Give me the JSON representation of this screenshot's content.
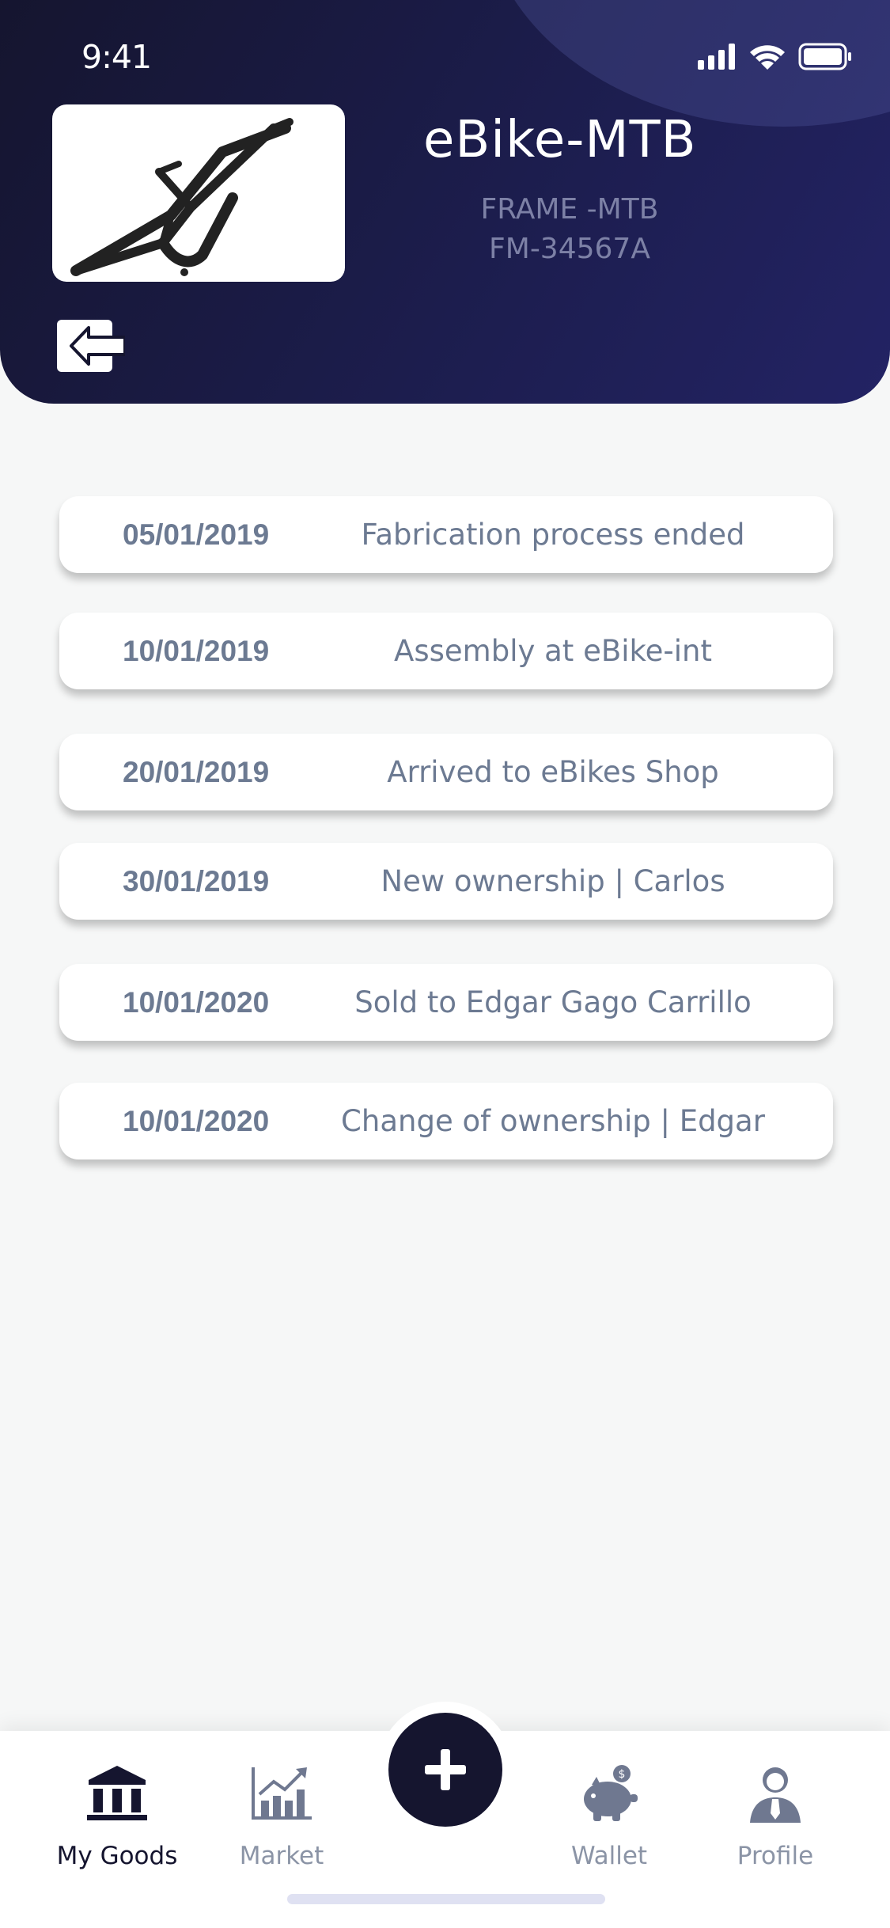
{
  "status_bar": {
    "time": "9:41"
  },
  "product": {
    "title": "eBike-MTB",
    "subtitle_line1": "FRAME -MTB",
    "subtitle_line2": "FM-34567A"
  },
  "events": [
    {
      "date": "05/01/2019",
      "description": "Fabrication process ended"
    },
    {
      "date": "10/01/2019",
      "description": "Assembly at eBike-int"
    },
    {
      "date": "20/01/2019",
      "description": "Arrived to eBikes Shop"
    },
    {
      "date": "30/01/2019",
      "description": "New ownership | Carlos"
    },
    {
      "date": "10/01/2020",
      "description": "Sold to Edgar Gago Carrillo"
    },
    {
      "date": "10/01/2020",
      "description": "Change of ownership | Edgar"
    }
  ],
  "tabbar": {
    "tabs": [
      {
        "label": "My Goods",
        "icon": "bank-icon",
        "active": true
      },
      {
        "label": "Market",
        "icon": "chart-growth-icon",
        "active": false
      },
      {
        "label": "Wallet",
        "icon": "piggy-bank-icon",
        "active": false
      },
      {
        "label": "Profile",
        "icon": "user-tie-icon",
        "active": false
      }
    ],
    "fab_icon": "plus-icon"
  },
  "colors": {
    "header_dark": "#15152f",
    "header_accent": "#232364",
    "muted_text": "#6c7a92",
    "tab_inactive": "#8b94a6",
    "tab_active": "#15152f"
  }
}
